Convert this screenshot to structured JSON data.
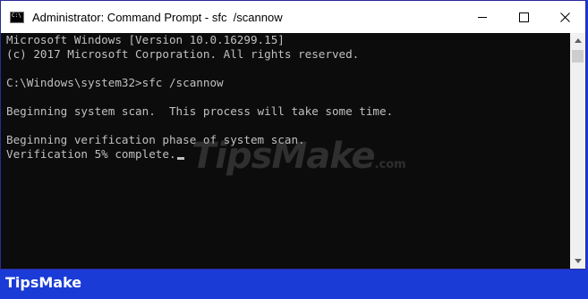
{
  "window": {
    "title": "Administrator: Command Prompt - sfc  /scannow",
    "app_icon": "cmd-icon",
    "controls": [
      {
        "name": "minimize",
        "icon": "minimize-icon"
      },
      {
        "name": "maximize",
        "icon": "maximize-icon"
      },
      {
        "name": "close",
        "icon": "close-icon"
      }
    ]
  },
  "console": {
    "lines": [
      "Microsoft Windows [Version 10.0.16299.15]",
      "(c) 2017 Microsoft Corporation. All rights reserved.",
      "",
      "C:\\Windows\\system32>sfc /scannow",
      "",
      "Beginning system scan.  This process will take some time.",
      "",
      "Beginning verification phase of system scan.",
      "Verification 5% complete."
    ],
    "text_color": "#c0c0c0",
    "background": "#0c0c0c"
  },
  "watermark": {
    "text": "TipsMake",
    "suffix": ".com"
  },
  "footer": {
    "brand": "TipsMake",
    "background": "#1a3bd6"
  }
}
